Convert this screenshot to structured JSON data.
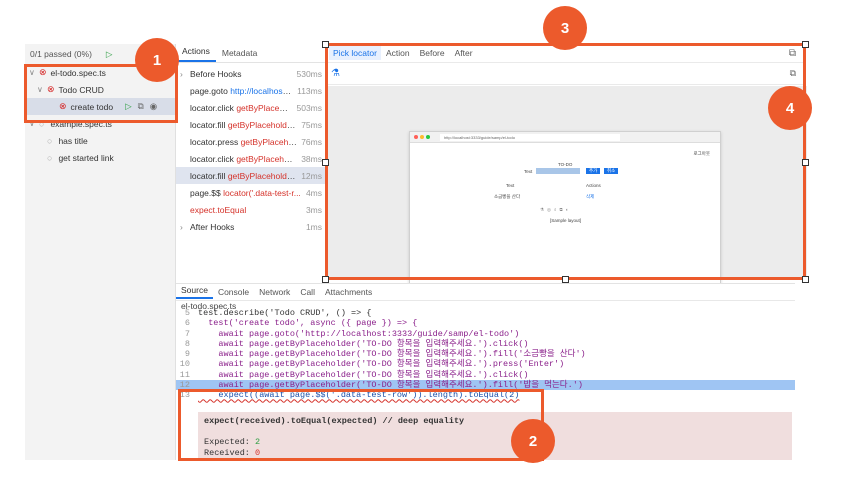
{
  "tree": {
    "summary": "0/1 passed (0%)",
    "files": [
      {
        "label": "el-todo.spec.ts",
        "status": "failed"
      },
      {
        "label": "Todo CRUD",
        "status": "failed"
      },
      {
        "label": "create todo",
        "status": "failed"
      },
      {
        "label": "example.spec.ts",
        "status": "none"
      },
      {
        "label": "has title",
        "status": "none"
      },
      {
        "label": "get started link",
        "status": "none"
      }
    ]
  },
  "actions": {
    "tabs": [
      "Actions",
      "Metadata"
    ],
    "rows": [
      {
        "name": "Before Hooks",
        "arg": "",
        "dur": "530ms"
      },
      {
        "name": "page.goto",
        "arg": "http://localhost:...",
        "dur": "113ms"
      },
      {
        "name": "locator.click",
        "arg": "getByPlaceho...",
        "dur": "503ms"
      },
      {
        "name": "locator.fill",
        "arg": "getByPlaceholder...",
        "dur": "75ms"
      },
      {
        "name": "locator.press",
        "arg": "getByPlacehol...",
        "dur": "76ms"
      },
      {
        "name": "locator.click",
        "arg": "getByPlacehol...",
        "dur": "38ms"
      },
      {
        "name": "locator.fill",
        "arg": "getByPlaceholder...",
        "dur": "12ms"
      },
      {
        "name": "page.$$",
        "arg": "locator('.data-test-r...",
        "dur": "4ms"
      },
      {
        "name": "expect.toEqual",
        "arg": "",
        "dur": "3ms"
      },
      {
        "name": "After Hooks",
        "arg": "",
        "dur": "1ms"
      }
    ]
  },
  "snapshot": {
    "tabs": [
      "Pick locator",
      "Action",
      "Before",
      "After"
    ],
    "browser_url": "http://localhost:3333/guide/samp/el-todo",
    "page_title": "TO-DO",
    "text_label": "Text",
    "add_btn": "추가",
    "cancel_btn": "취소",
    "col_text": "Text",
    "col_actions": "Actions",
    "row_text": "소금빵을 산다",
    "row_action": "삭제",
    "corner_link": "로그아웃",
    "footer_text": "[Sample layout]"
  },
  "bottom": {
    "tabs": [
      "Source",
      "Console",
      "Network",
      "Call",
      "Attachments"
    ],
    "filename": "el-todo.spec.ts",
    "lines": [
      {
        "n": "5",
        "code": "test.describe('Todo CRUD', () => {"
      },
      {
        "n": "6",
        "code": "  test('create todo', async ({ page }) => {"
      },
      {
        "n": "7",
        "code": "    await page.goto('http://localhost:3333/guide/samp/el-todo')"
      },
      {
        "n": "8",
        "code": "    await page.getByPlaceholder('TO-DO 항목을 입력해주세요.').click()"
      },
      {
        "n": "9",
        "code": "    await page.getByPlaceholder('TO-DO 항목을 입력해주세요.').fill('소금빵을 산다')"
      },
      {
        "n": "10",
        "code": "    await page.getByPlaceholder('TO-DO 항목을 입력해주세요.').press('Enter')"
      },
      {
        "n": "11",
        "code": "    await page.getByPlaceholder('TO-DO 항목을 입력해주세요.').click()"
      },
      {
        "n": "12",
        "code": "    await page.getByPlaceholder('TO-DO 항목을 입력해주세요.').fill('밥을 먹는다.')"
      },
      {
        "n": "13",
        "code": "    expect((await page.$$('.data-test-row')).length).toEqual(2)"
      }
    ],
    "error": {
      "line1": "expect(received).toEqual(expected) // deep equality",
      "expected_label": "Expected: ",
      "expected_val": "2",
      "received_label": "Received: ",
      "received_val": "0"
    }
  },
  "callouts": [
    "1",
    "2",
    "3",
    "4"
  ],
  "colors": {
    "accent": "#ec5a2c",
    "link": "#1a73e8",
    "fail": "#d52a2a",
    "pass": "#2e9e43",
    "highlight": "#9fc5f3"
  }
}
